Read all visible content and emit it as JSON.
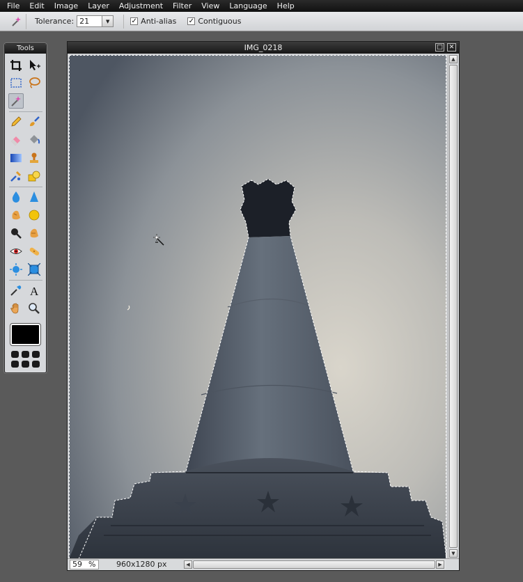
{
  "menu": [
    "File",
    "Edit",
    "Image",
    "Layer",
    "Adjustment",
    "Filter",
    "View",
    "Language",
    "Help"
  ],
  "options": {
    "tool_icon": "magic-wand-icon",
    "tolerance_label": "Tolerance:",
    "tolerance_value": "21",
    "anti_alias_label": "Anti-alias",
    "anti_alias_checked": true,
    "contiguous_label": "Contiguous",
    "contiguous_checked": true
  },
  "tools": {
    "title": "Tools",
    "selected": "magic-wand-icon",
    "foreground_color": "#000000",
    "icons": [
      "crop-icon",
      "move-icon",
      "marquee-icon",
      "lasso-icon",
      "magic-wand-icon",
      "pencil-icon",
      "brush-icon",
      "eraser-icon",
      "paint-bucket-icon",
      "gradient-icon",
      "clone-stamp-icon",
      "color-replace-icon",
      "shape-icon",
      "blur-icon",
      "sharpen-icon",
      "smudge-icon",
      "sponge-icon",
      "burn-icon",
      "dodge-icon",
      "red-eye-icon",
      "spot-heal-icon",
      "bloat-icon",
      "pinch-icon",
      "color-picker-icon",
      "type-icon",
      "hand-icon",
      "zoom-icon"
    ]
  },
  "document": {
    "title": "IMG_0218",
    "zoom": "59",
    "zoom_unit": "%",
    "dimensions": "960x1280 px"
  }
}
